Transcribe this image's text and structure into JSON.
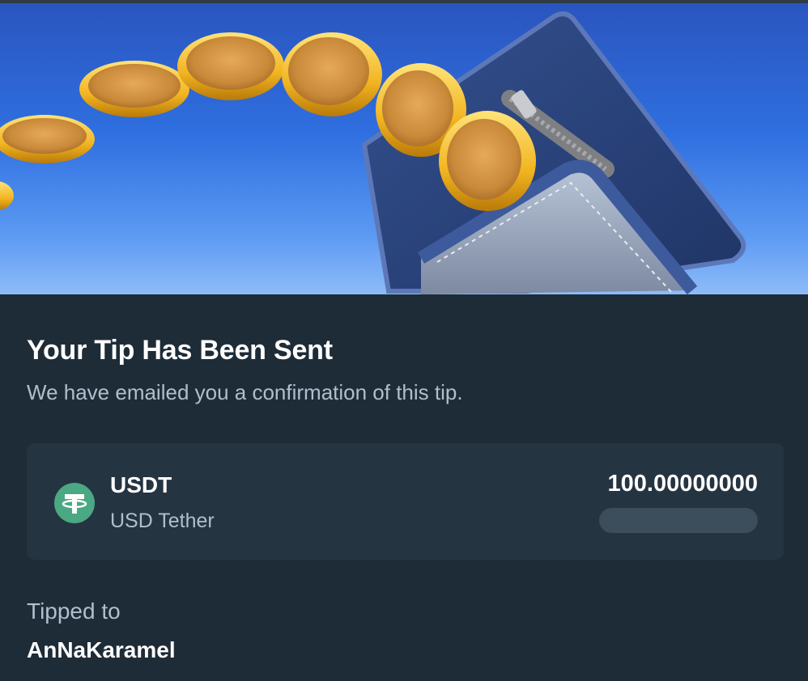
{
  "dialog": {
    "title": "Your Tip Has Been Sent",
    "subtitle": "We have emailed you a confirmation of this tip."
  },
  "currency": {
    "ticker": "USDT",
    "name": "USD Tether",
    "amount": "100.00000000",
    "icon": "tether-icon",
    "icon_color": "#4aa883"
  },
  "recipient": {
    "label": "Tipped to",
    "username": "AnNaKaramel"
  },
  "colors": {
    "background": "#1e2c37",
    "card": "#253441",
    "muted_text": "#b0bfcd",
    "placeholder_bar": "#3c4d5b"
  }
}
